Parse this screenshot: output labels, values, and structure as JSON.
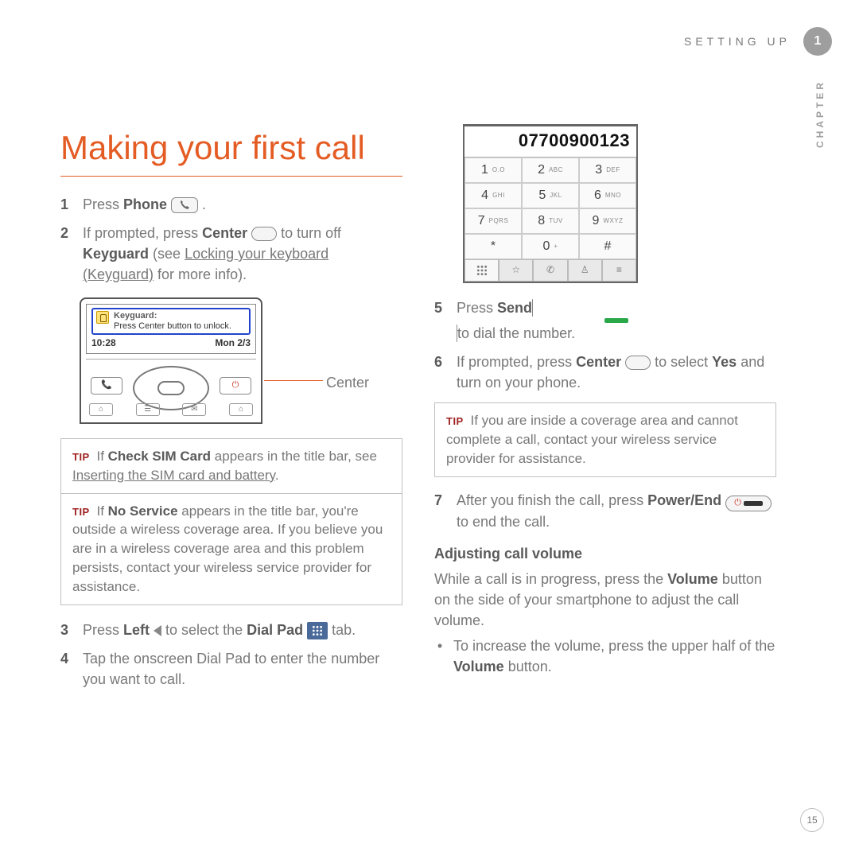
{
  "header": {
    "section": "SETTING UP",
    "chapter_number": "1",
    "chapter_label": "CHAPTER"
  },
  "title": "Making your first call",
  "left": {
    "steps": [
      {
        "num": "1",
        "lead": "Press ",
        "bold1": "Phone",
        "tail": " ."
      },
      {
        "num": "2",
        "lead": "If prompted, press ",
        "bold1": "Center",
        "mid": " to turn off ",
        "bold2": "Keyguard",
        "mid2": " (see ",
        "link": "Locking your keyboard (Keyguard)",
        "tail": " for more info)."
      },
      {
        "num": "3",
        "lead": "Press ",
        "bold1": "Left",
        "mid": " to select the ",
        "bold2": "Dial Pad",
        "tail": " tab."
      },
      {
        "num": "4",
        "text": "Tap the onscreen Dial Pad to enter the number you want to call."
      }
    ],
    "device": {
      "keyguard_title": "Keyguard:",
      "keyguard_msg": "Press Center button to unlock.",
      "time": "10:28",
      "date": "Mon 2/3",
      "callout": "Center"
    },
    "tip1": {
      "pre": "If ",
      "bold": "Check SIM Card",
      "mid": " appears in the title bar, see ",
      "link": "Inserting the SIM card and battery",
      "tail": "."
    },
    "tip2": {
      "pre": "If ",
      "bold": "No Service",
      "tail": " appears in the title bar, you're outside a wireless coverage area. If you believe you are in a wireless coverage area and this problem persists, contact your wireless service provider for assistance."
    }
  },
  "right": {
    "keypad": {
      "display": "07700900123",
      "keys": [
        [
          "1",
          "O.O"
        ],
        [
          "2",
          "ABC"
        ],
        [
          "3",
          "DEF"
        ],
        [
          "4",
          "GHI"
        ],
        [
          "5",
          "JKL"
        ],
        [
          "6",
          "MNO"
        ],
        [
          "7",
          "PQRS"
        ],
        [
          "8",
          "TUV"
        ],
        [
          "9",
          "WXYZ"
        ],
        [
          "*",
          ""
        ],
        [
          "0",
          "+"
        ],
        [
          "#",
          ""
        ]
      ]
    },
    "steps": [
      {
        "num": "5",
        "lead": "Press ",
        "bold1": "Send",
        "tail": " to dial the number."
      },
      {
        "num": "6",
        "lead": "If prompted, press ",
        "bold1": "Center",
        "mid": " to select ",
        "bold2": "Yes",
        "tail": " and turn on your phone."
      },
      {
        "num": "7",
        "lead": "After you finish the call, press ",
        "bold1": "Power/End",
        "tail": " to end the call."
      }
    ],
    "tip": "If you are inside a coverage area and cannot complete a call, contact your wireless service provider for assistance.",
    "subhead": "Adjusting call volume",
    "subtext_a": "While a call is in progress, press the ",
    "subtext_bold": "Volume",
    "subtext_b": " button on the side of your smartphone to adjust the call volume.",
    "bullet_a": "To increase the volume, press the upper half of the ",
    "bullet_bold": "Volume",
    "bullet_b": " button."
  },
  "tip_label": "TIP",
  "page_number": "15"
}
